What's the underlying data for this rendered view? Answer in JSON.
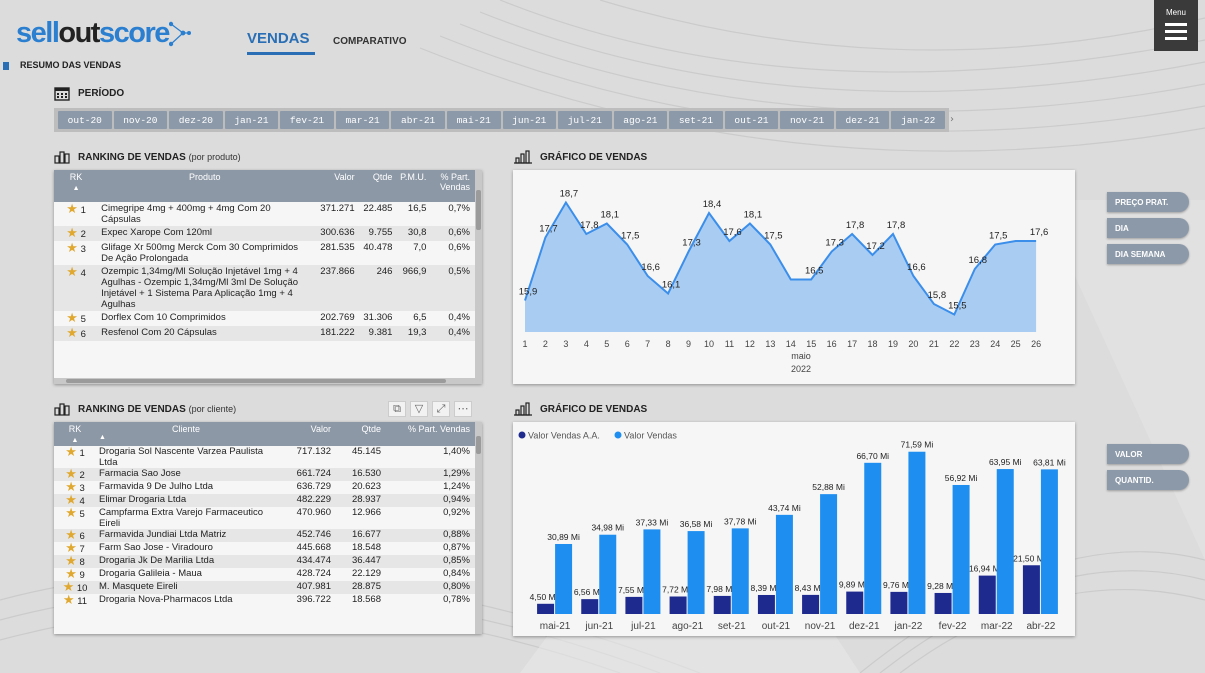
{
  "header": {
    "logo": {
      "part1": "sell",
      "part2": "out",
      "part3": "score"
    },
    "nav_active": "VENDAS",
    "nav_other": "COMPARATIVO",
    "section": "RESUMO DAS VENDAS",
    "menu_label": "Menu"
  },
  "period": {
    "title": "PERÍODO",
    "months": [
      "out-20",
      "nov-20",
      "dez-20",
      "jan-21",
      "fev-21",
      "mar-21",
      "abr-21",
      "mai-21",
      "jun-21",
      "jul-21",
      "ago-21",
      "set-21",
      "out-21",
      "nov-21",
      "dez-21",
      "jan-22"
    ]
  },
  "ranking_produto": {
    "title": "RANKING DE VENDAS",
    "subtitle": "(por produto)",
    "headers": {
      "rk": "RK",
      "produto": "Produto",
      "valor": "Valor",
      "qtde": "Qtde",
      "pmu": "P.M.U.",
      "part": "% Part. Vendas"
    },
    "rows": [
      {
        "rk": "1",
        "produto": "Cimegripe 4mg + 400mg + 4mg Com 20 Cápsulas",
        "valor": "371.271",
        "qtde": "22.485",
        "pmu": "16,5",
        "part": "0,7%"
      },
      {
        "rk": "2",
        "produto": "Expec Xarope Com 120ml",
        "valor": "300.636",
        "qtde": "9.755",
        "pmu": "30,8",
        "part": "0,6%"
      },
      {
        "rk": "3",
        "produto": "Glifage Xr 500mg Merck Com 30 Comprimidos De Ação Prolongada",
        "valor": "281.535",
        "qtde": "40.478",
        "pmu": "7,0",
        "part": "0,6%"
      },
      {
        "rk": "4",
        "produto": "Ozempic 1,34mg/Ml Solução Injetável 1mg + 4 Agulhas - Ozempic 1,34mg/Ml 3ml De Solução Injetável + 1 Sistema Para Aplicação 1mg + 4 Agulhas",
        "valor": "237.866",
        "qtde": "246",
        "pmu": "966,9",
        "part": "0,5%"
      },
      {
        "rk": "5",
        "produto": "Dorflex Com 10 Comprimidos",
        "valor": "202.769",
        "qtde": "31.306",
        "pmu": "6,5",
        "part": "0,4%"
      },
      {
        "rk": "6",
        "produto": "Resfenol Com 20 Cápsulas",
        "valor": "181.222",
        "qtde": "9.381",
        "pmu": "19,3",
        "part": "0,4%"
      }
    ]
  },
  "ranking_cliente": {
    "title": "RANKING DE VENDAS",
    "subtitle": "(por cliente)",
    "headers": {
      "rk": "RK",
      "cliente": "Cliente",
      "valor": "Valor",
      "qtde": "Qtde",
      "part": "% Part. Vendas"
    },
    "rows": [
      {
        "rk": "1",
        "cliente": "Drogaria Sol Nascente Varzea Paulista Ltda",
        "valor": "717.132",
        "qtde": "45.145",
        "part": "1,40%"
      },
      {
        "rk": "2",
        "cliente": "Farmacia Sao Jose",
        "valor": "661.724",
        "qtde": "16.530",
        "part": "1,29%"
      },
      {
        "rk": "3",
        "cliente": "Farmavida 9 De Julho Ltda",
        "valor": "636.729",
        "qtde": "20.623",
        "part": "1,24%"
      },
      {
        "rk": "4",
        "cliente": "Elimar Drogaria Ltda",
        "valor": "482.229",
        "qtde": "28.937",
        "part": "0,94%"
      },
      {
        "rk": "5",
        "cliente": "Campfarma Extra Varejo Farmaceutico Eireli",
        "valor": "470.960",
        "qtde": "12.966",
        "part": "0,92%"
      },
      {
        "rk": "6",
        "cliente": "Farmavida Jundiai Ltda Matriz",
        "valor": "452.746",
        "qtde": "16.677",
        "part": "0,88%"
      },
      {
        "rk": "7",
        "cliente": "Farm Sao Jose - Viradouro",
        "valor": "445.668",
        "qtde": "18.548",
        "part": "0,87%"
      },
      {
        "rk": "8",
        "cliente": "Drogaria Jk De Marilia Ltda",
        "valor": "434.474",
        "qtde": "36.447",
        "part": "0,85%"
      },
      {
        "rk": "9",
        "cliente": "Drogaria Galileia - Maua",
        "valor": "428.724",
        "qtde": "22.129",
        "part": "0,84%"
      },
      {
        "rk": "10",
        "cliente": "M. Masquete Eireli",
        "valor": "407.981",
        "qtde": "28.875",
        "part": "0,80%"
      },
      {
        "rk": "11",
        "cliente": "Drogaria Nova-Pharmacos Ltda",
        "valor": "396.722",
        "qtde": "18.568",
        "part": "0,78%"
      }
    ]
  },
  "side_buttons_top": [
    "PREÇO PRAT.",
    "DIA",
    "DIA SEMANA"
  ],
  "side_buttons_bottom": [
    "VALOR",
    "QUANTID."
  ],
  "chart_data": [
    {
      "type": "area",
      "title": "GRÁFICO DE VENDAS",
      "x": [
        1,
        2,
        3,
        4,
        5,
        6,
        7,
        8,
        9,
        10,
        11,
        12,
        13,
        14,
        15,
        16,
        17,
        18,
        19,
        20,
        21,
        22,
        23,
        24,
        25,
        26
      ],
      "labels": [
        "15,9",
        "17,7",
        "18,7",
        "17,8",
        "18,1",
        "17,5",
        "16,6",
        "16,1",
        "17,3",
        "18,4",
        "17,6",
        "18,1",
        "17,5",
        "",
        "16,5",
        "17,3",
        "17,8",
        "17,2",
        "17,8",
        "16,6",
        "15,8",
        "15,5",
        "16,8",
        "17,5",
        "",
        "17,6"
      ],
      "values": [
        15.9,
        17.7,
        18.7,
        17.8,
        18.1,
        17.5,
        16.6,
        16.1,
        17.3,
        18.4,
        17.6,
        18.1,
        17.5,
        16.5,
        16.5,
        17.3,
        17.8,
        17.2,
        17.8,
        16.6,
        15.8,
        15.5,
        16.8,
        17.5,
        17.6,
        17.6
      ],
      "xlabel": "maio",
      "xlabel2": "2022",
      "ylim": [
        15,
        19
      ],
      "color": "#3b8eea",
      "fill": "#a9cdf2"
    },
    {
      "type": "bar",
      "title": "GRÁFICO DE VENDAS",
      "categories": [
        "mai-21",
        "jun-21",
        "jul-21",
        "ago-21",
        "set-21",
        "out-21",
        "nov-21",
        "dez-21",
        "jan-22",
        "fev-22",
        "mar-22",
        "abr-22"
      ],
      "series": [
        {
          "name": "Valor Vendas A.A.",
          "color": "#1f2a8f",
          "values": [
            4.5,
            6.56,
            7.55,
            7.72,
            7.98,
            8.39,
            8.43,
            9.89,
            9.76,
            9.28,
            16.94,
            21.5
          ],
          "labels": [
            "4,50 Mi",
            "6,56 Mi",
            "7,55 Mi",
            "7,72 Mi",
            "7,98 Mi",
            "8,39 Mi",
            "8,43 Mi",
            "9,89 Mi",
            "9,76 Mi",
            "9,28 Mi",
            "16,94 Mi",
            "21,50 Mi"
          ]
        },
        {
          "name": "Valor Vendas",
          "color": "#1e8ff0",
          "values": [
            30.89,
            34.98,
            37.33,
            36.58,
            37.78,
            43.74,
            52.88,
            66.7,
            71.59,
            56.92,
            63.95,
            63.81
          ],
          "labels": [
            "30,89 Mi",
            "34,98 Mi",
            "37,33 Mi",
            "36,58 Mi",
            "37,78 Mi",
            "43,74 Mi",
            "52,88 Mi",
            "66,70 Mi",
            "71,59 Mi",
            "56,92 Mi",
            "63,95 Mi",
            "63,81 Mi"
          ]
        }
      ],
      "ylim": [
        0,
        75
      ]
    }
  ]
}
